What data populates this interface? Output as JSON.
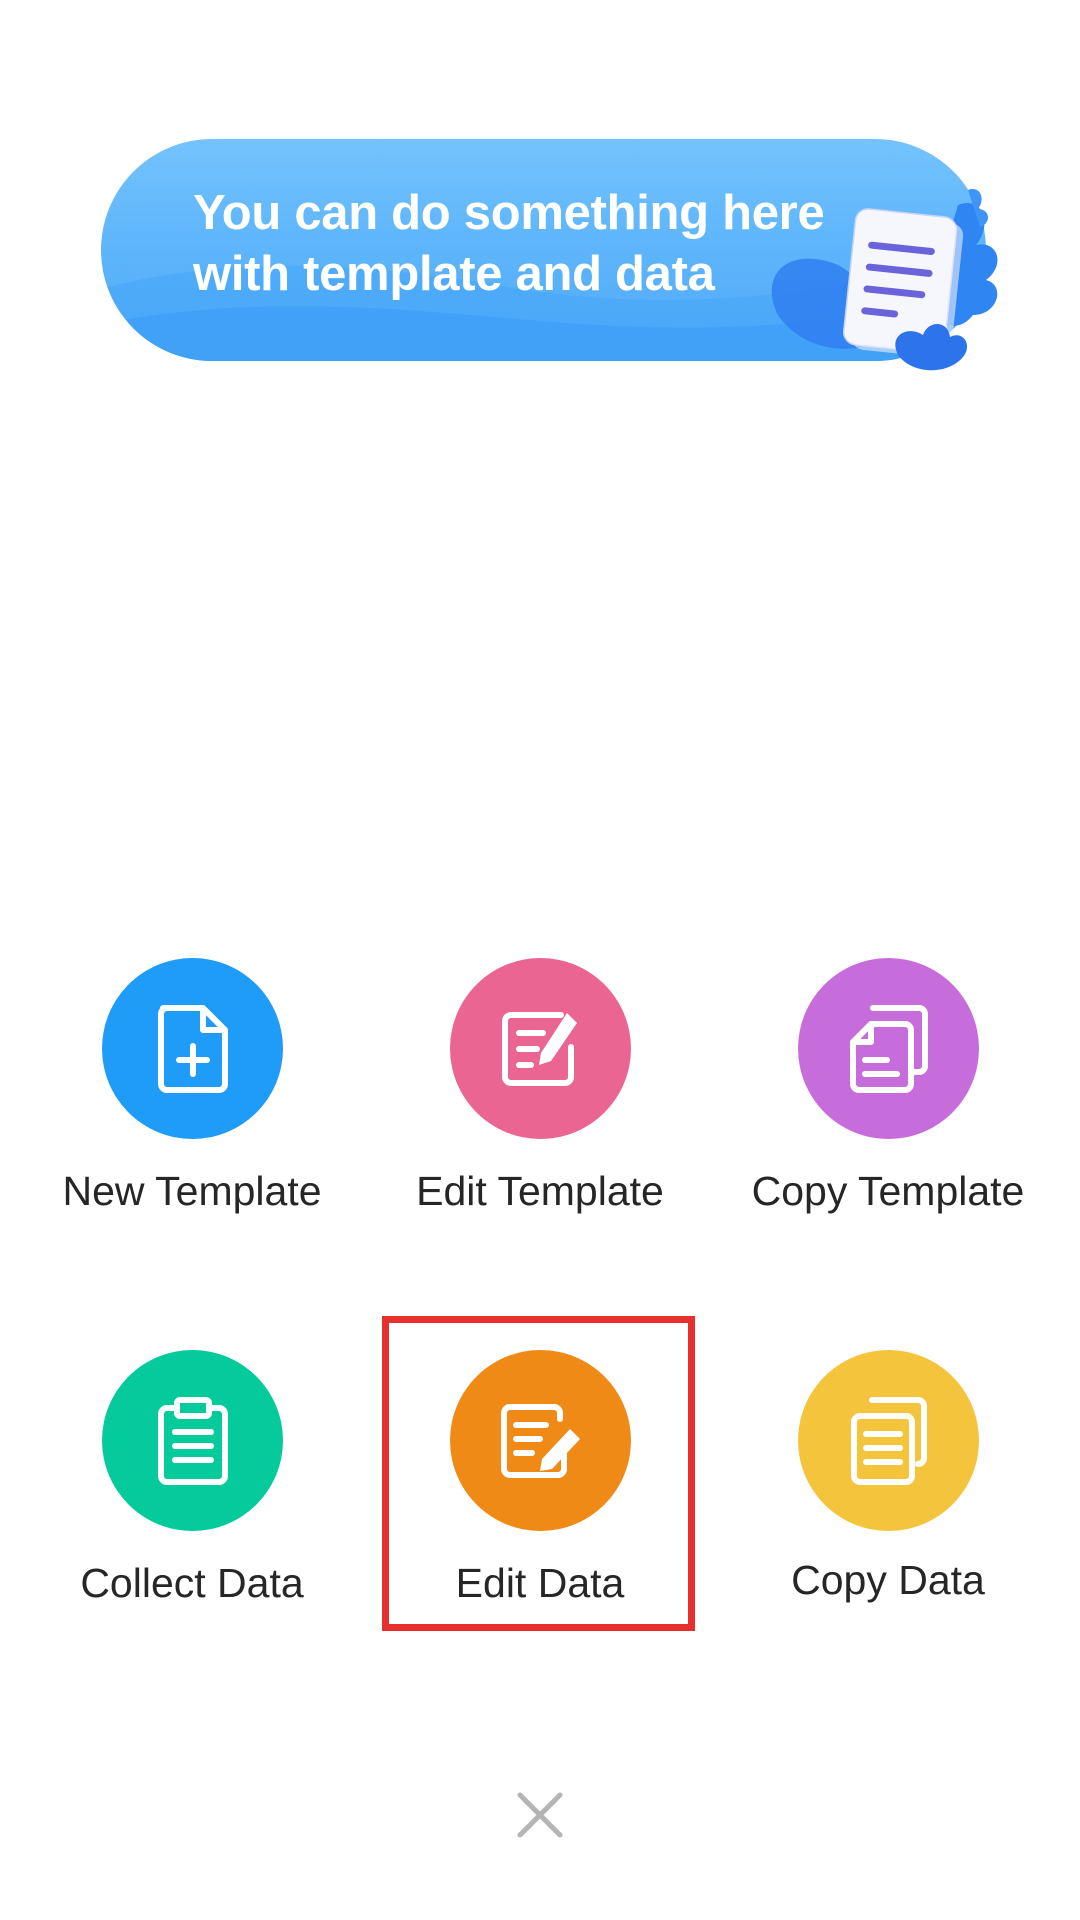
{
  "banner": {
    "line1": "You can do something here",
    "line2": "with template and data",
    "illustration_icon": "document-leaves-illustration"
  },
  "actions": [
    {
      "label": "New Template",
      "icon": "new-file-icon",
      "color": "#1f9bf8"
    },
    {
      "label": "Edit Template",
      "icon": "edit-file-icon",
      "color": "#eb6593"
    },
    {
      "label": "Copy Template",
      "icon": "copy-file-icon",
      "color": "#c76ddb"
    },
    {
      "label": "Collect Data",
      "icon": "clipboard-icon",
      "color": "#05cb9c"
    },
    {
      "label": "Edit Data",
      "icon": "edit-document-icon",
      "color": "#f08a17"
    },
    {
      "label": "Copy Data",
      "icon": "copy-document-icon",
      "color": "#f3c43c"
    }
  ],
  "highlighted_action": "Edit Data",
  "highlight_color": "#e5302e",
  "close": {
    "icon": "close-icon",
    "color": "#b4b4b4"
  }
}
